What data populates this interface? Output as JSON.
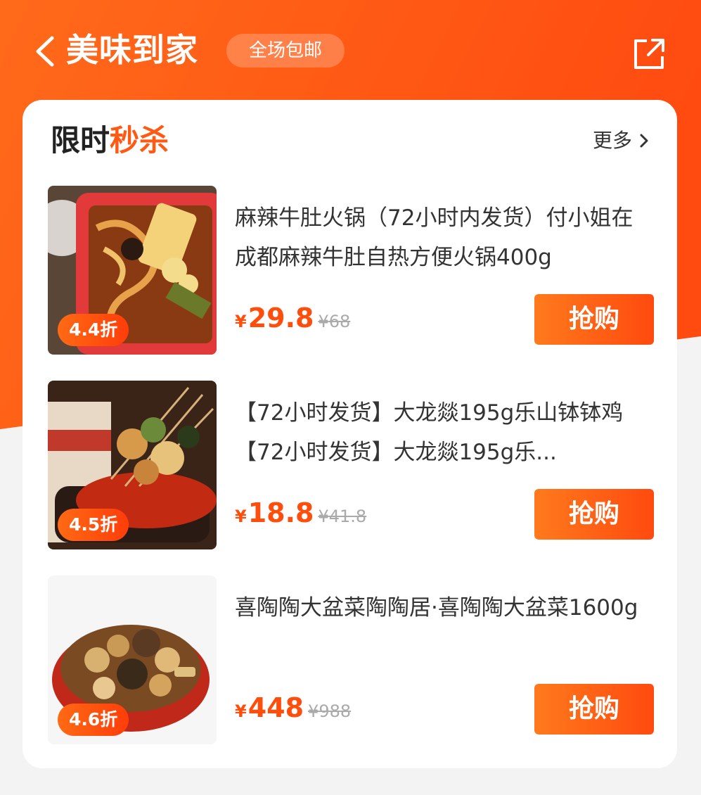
{
  "header": {
    "title": "美味到家",
    "badge": "全场包邮"
  },
  "section": {
    "title_plain": "限时",
    "title_highlight": "秒杀",
    "more_label": "更多"
  },
  "colors": {
    "brand_orange": "#ff5a14",
    "price_red": "#ff4d0c",
    "orig_price_gray": "#aaaaaa"
  },
  "items": [
    {
      "name": "麻辣牛肚火锅（72小时内发货）付小姐在成都麻辣牛肚自热方便火锅400g",
      "currency": "¥",
      "price": "29.8",
      "orig_currency": "¥",
      "orig_price": "68",
      "discount": "4.4折",
      "buy_label": "抢购",
      "image": "hotpot-box-image"
    },
    {
      "name": "【72小时发货】大龙燚195g乐山钵钵鸡【72小时发货】大龙燚195g乐...",
      "currency": "¥",
      "price": "18.8",
      "orig_currency": "¥",
      "orig_price": "41.8",
      "discount": "4.5折",
      "buy_label": "抢购",
      "image": "skewers-image"
    },
    {
      "name": "喜陶陶大盆菜陶陶居·喜陶陶大盆菜1600g",
      "currency": "¥",
      "price": "448",
      "orig_currency": "¥",
      "orig_price": "988",
      "discount": "4.6折",
      "buy_label": "抢购",
      "image": "big-bowl-dish-image"
    }
  ],
  "icons": {
    "back": "chevron-left-icon",
    "share": "share-icon",
    "more": "chevron-right-icon"
  }
}
